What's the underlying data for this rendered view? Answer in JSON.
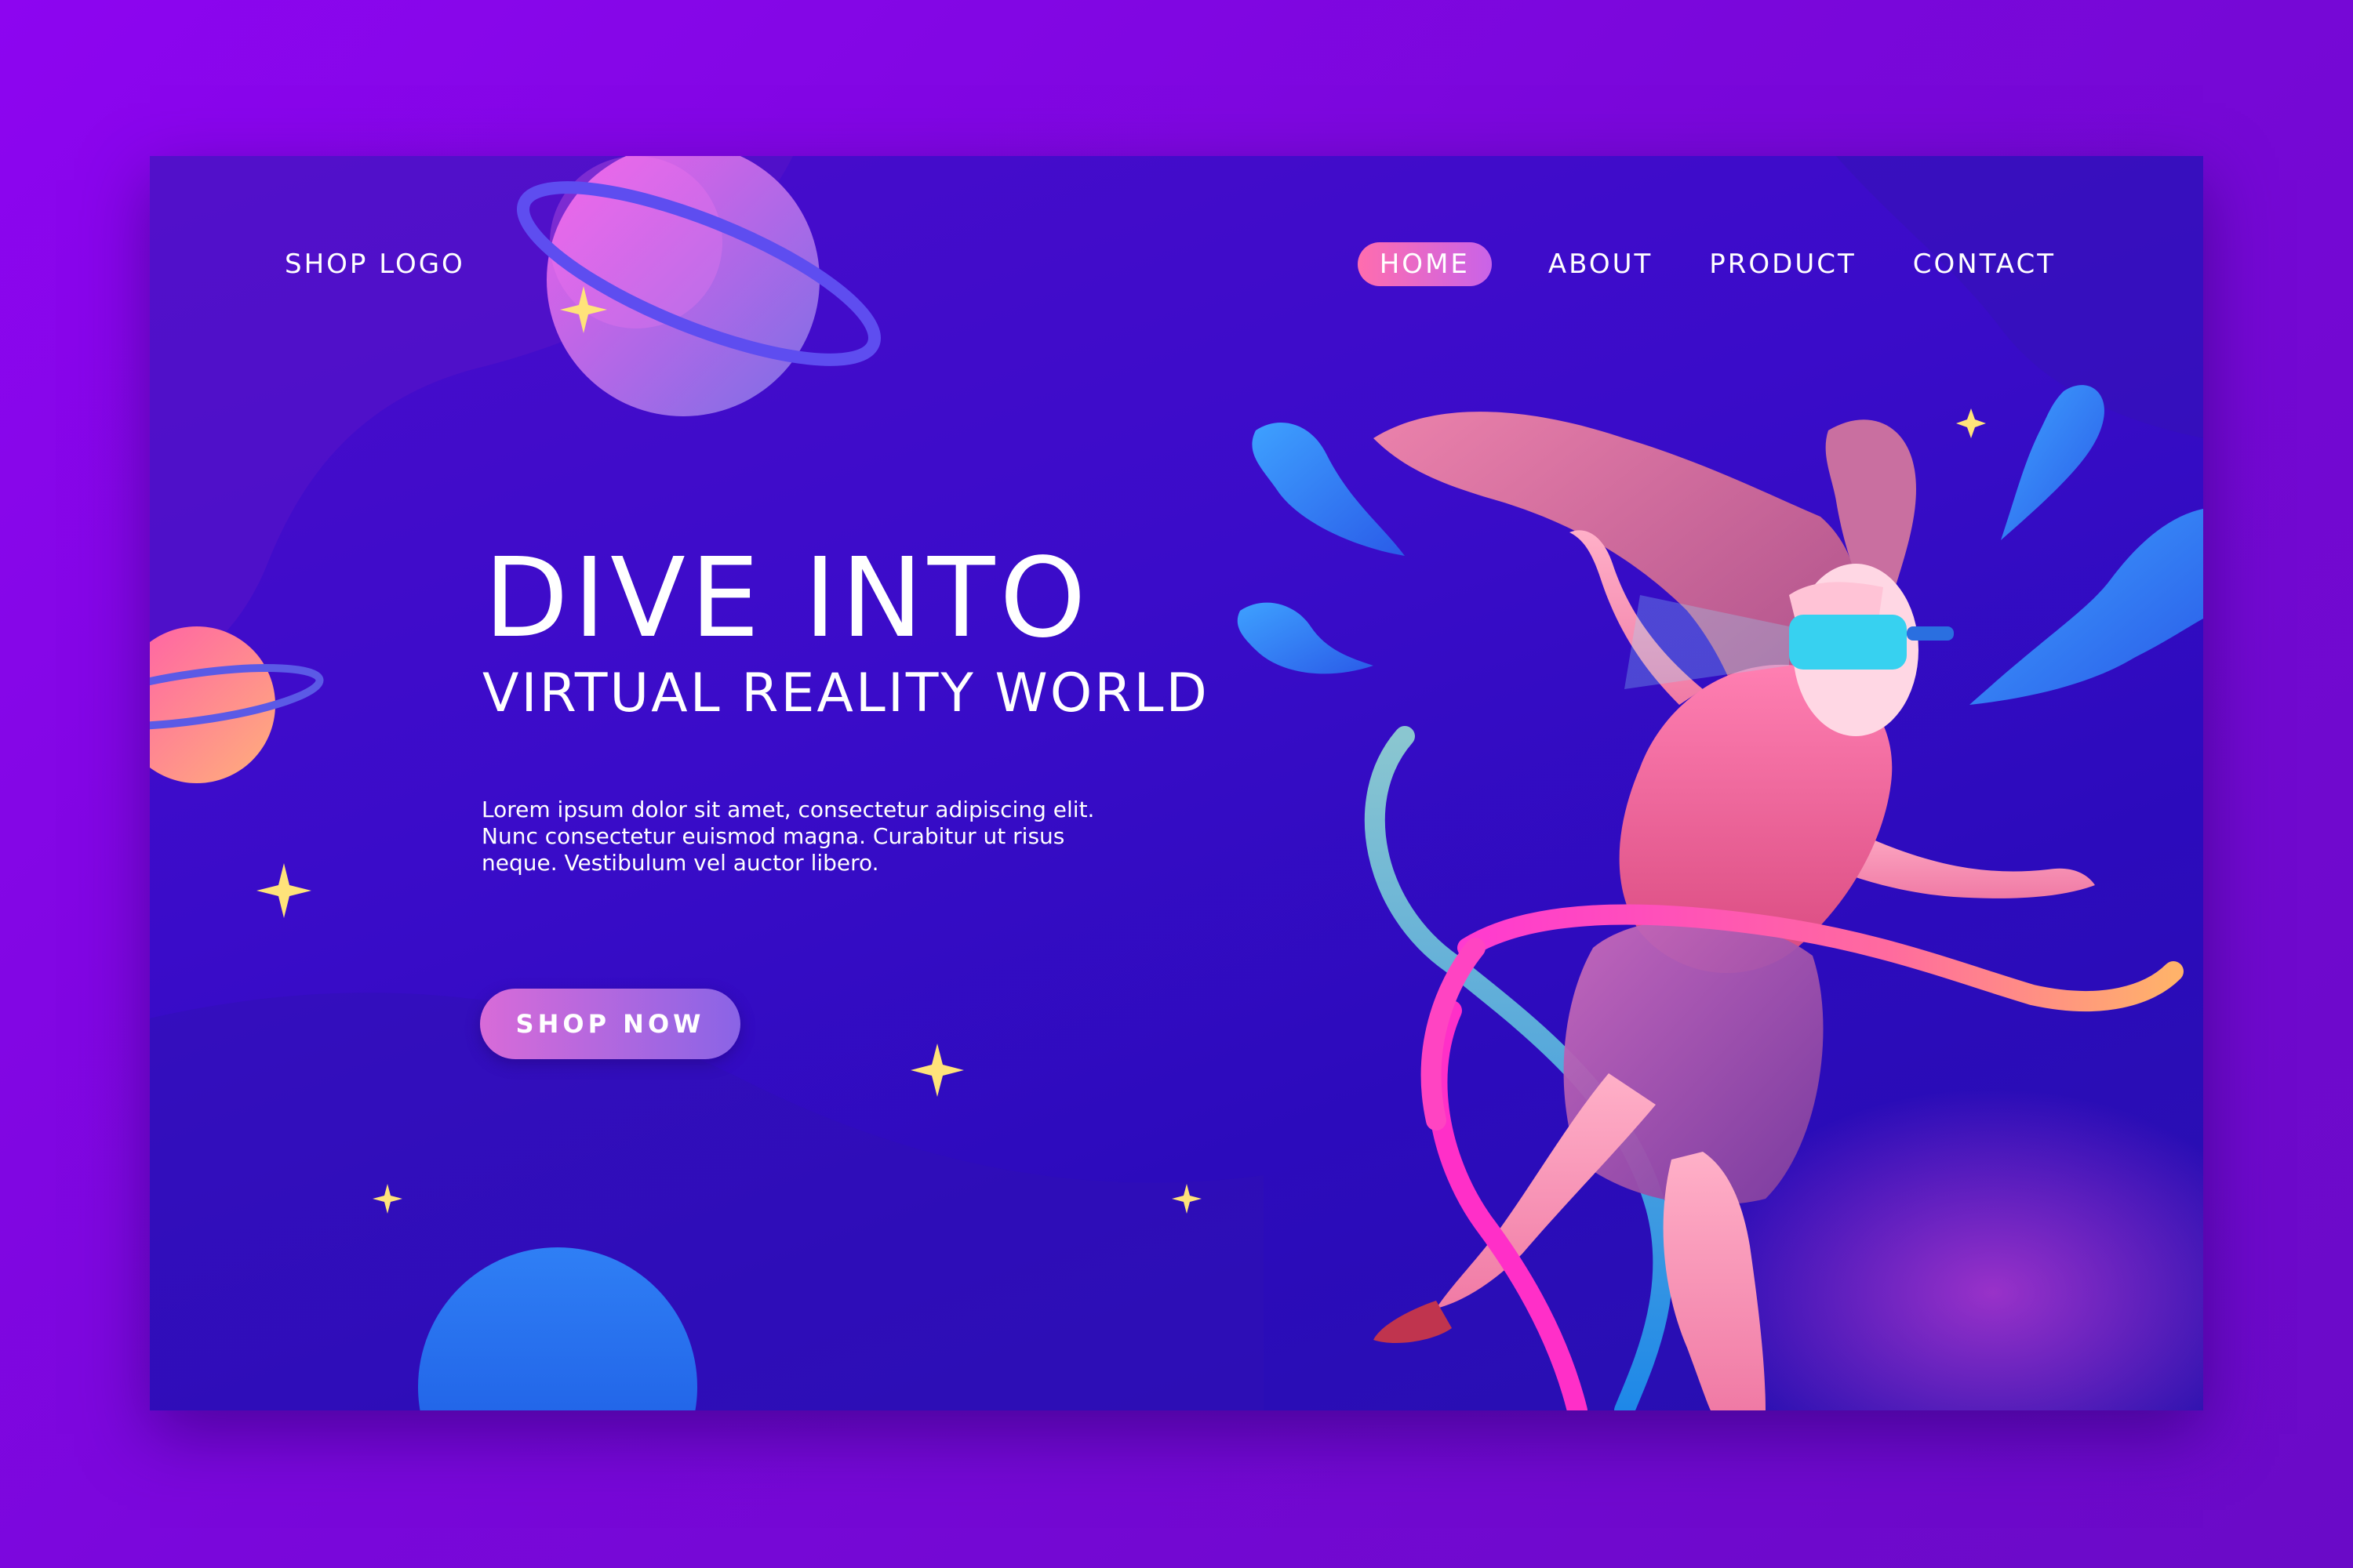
{
  "nav": {
    "logo": "SHOP LOGO",
    "items": [
      {
        "label": "HOME",
        "active": true
      },
      {
        "label": "ABOUT",
        "active": false
      },
      {
        "label": "PRODUCT",
        "active": false
      },
      {
        "label": "CONTACT",
        "active": false
      }
    ]
  },
  "hero": {
    "title": "DIVE INTO",
    "subtitle": "VIRTUAL REALITY WORLD",
    "body": "Lorem ipsum dolor sit amet, consectetur adipiscing elit. Nunc consectetur euismod magna. Curabitur ut risus neque. Vestibulum vel auctor libero.",
    "cta_label": "SHOP NOW"
  },
  "colors": {
    "page_background": "#8d05f0",
    "hero_background": "#3a0cc9",
    "accent_pink": "#ff6dae",
    "accent_blue": "#2f7ff5",
    "star_yellow": "#ffe37a"
  },
  "icons": {
    "stars": "sparkle-star-icon",
    "planets": "ringed-planet-icon"
  }
}
